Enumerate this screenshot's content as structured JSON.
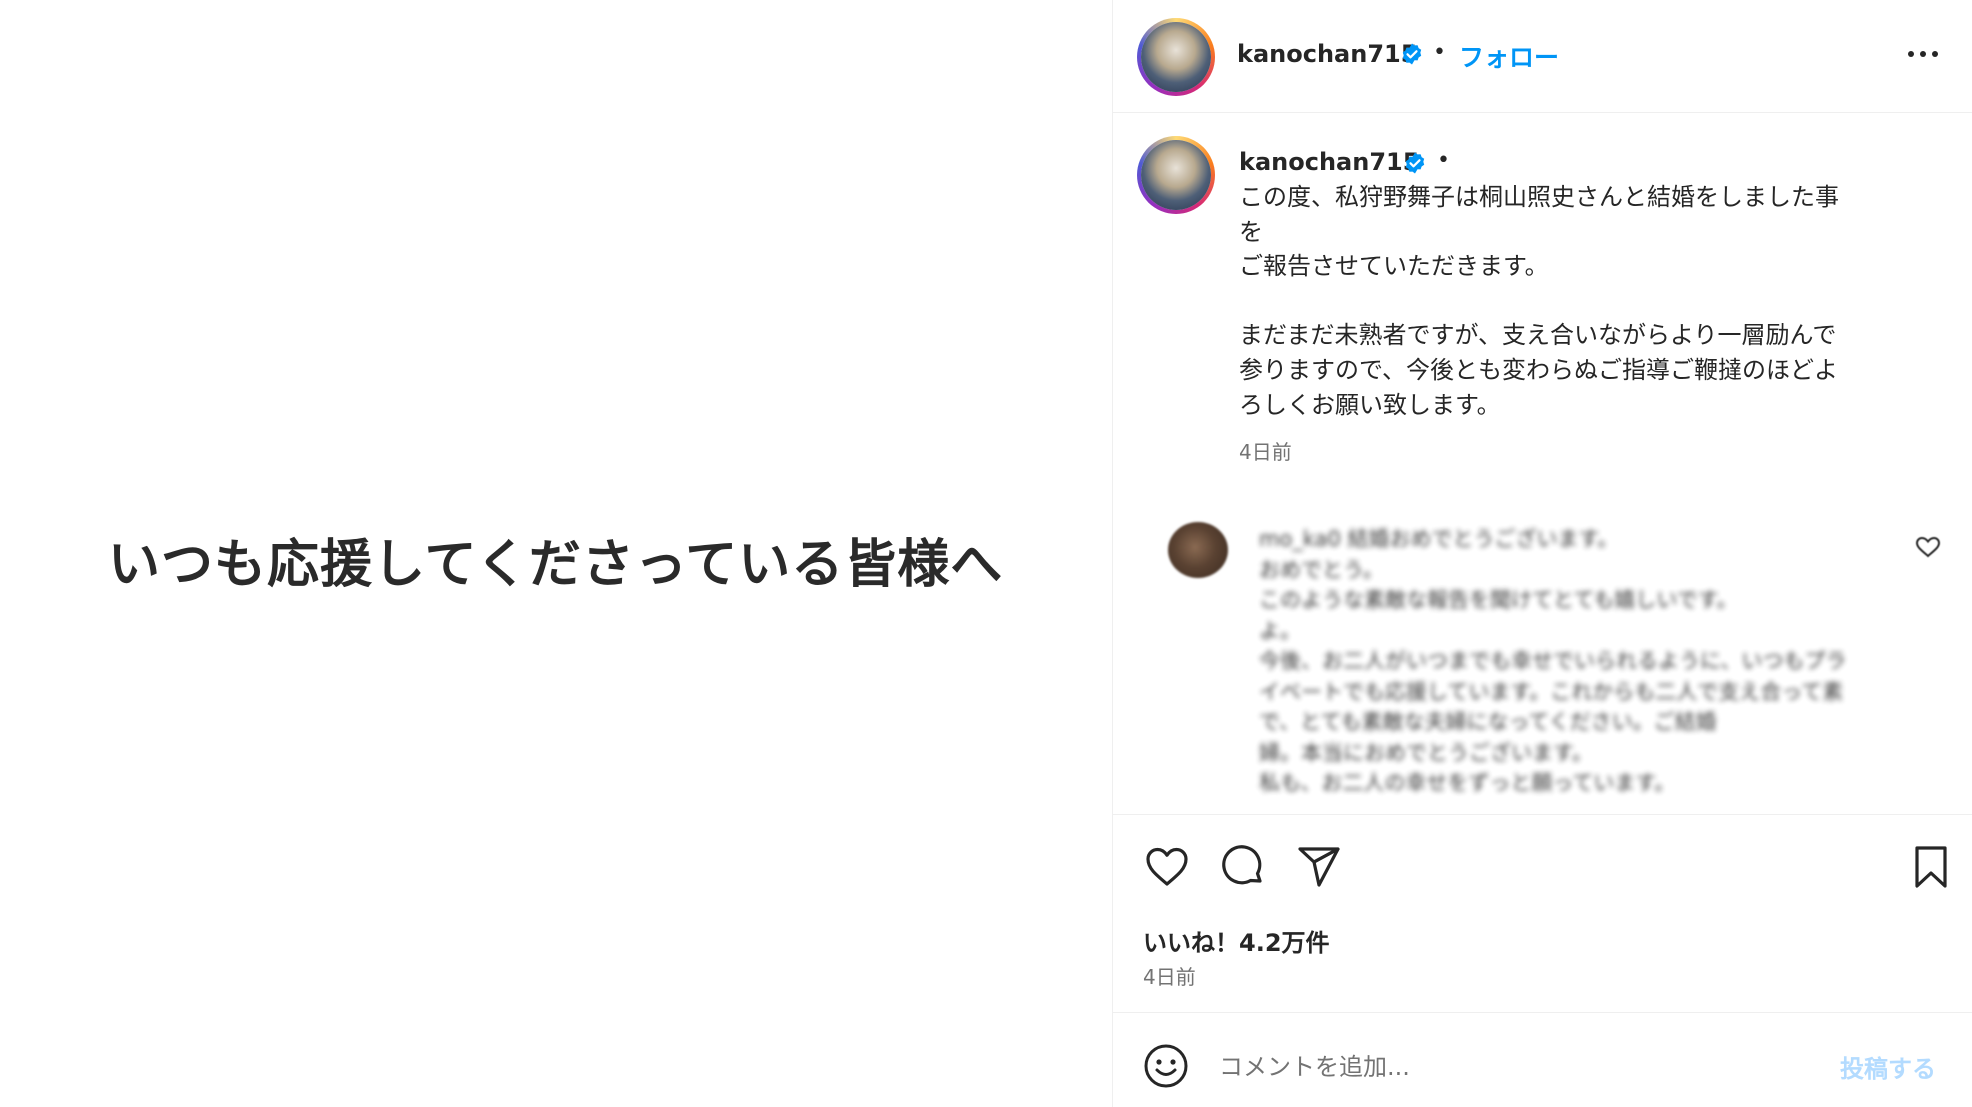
{
  "post_image": {
    "text": "いつも応援してくださっている皆様へ"
  },
  "header": {
    "username": "kanochan715",
    "separator": "•",
    "follow_label": "フォロー",
    "more_icon": "more-horizontal-icon",
    "verified_icon": "verified-badge-icon"
  },
  "caption": {
    "username": "kanochan715",
    "separator": "•",
    "text": "この度、私狩野舞子は桐山照史さんと結婚をしました事\nを\nご報告させていただきます。\n\nまだまだ未熟者ですが、支え合いながらより一層励んで\n参りますので、今後とも変わらぬご指導ご鞭撻のほどよ\nろしくお願い致します。",
    "time": "4日前"
  },
  "comment": {
    "text": "mo_ka0 結婚おめでとうございます。\nおめでとう。\nこのような素敵な報告を聞けてとても嬉しいです。\nよ。\n今後、お二人がいつまでも幸せでいられるように、いつもプラ\nイベートでも応援しています。これからも二人で支え合って素\nで、とても素敵な夫婦になってください。ご結婚\n婦。本当におめでとうございます。\n私も、お二人の幸せをずっと願っています。"
  },
  "actions": {
    "like_icon": "heart-icon",
    "comment_icon": "comment-icon",
    "share_icon": "send-icon",
    "save_icon": "bookmark-icon",
    "likes_text": "いいね！4.2万件",
    "time": "4日前"
  },
  "add_comment": {
    "emoji_icon": "emoji-icon",
    "placeholder": "コメントを追加...",
    "post_label": "投稿する"
  },
  "colors": {
    "accent": "#0095f6",
    "post_disabled": "#b3dbff",
    "secondary_text": "#737373",
    "border": "#efefef"
  }
}
